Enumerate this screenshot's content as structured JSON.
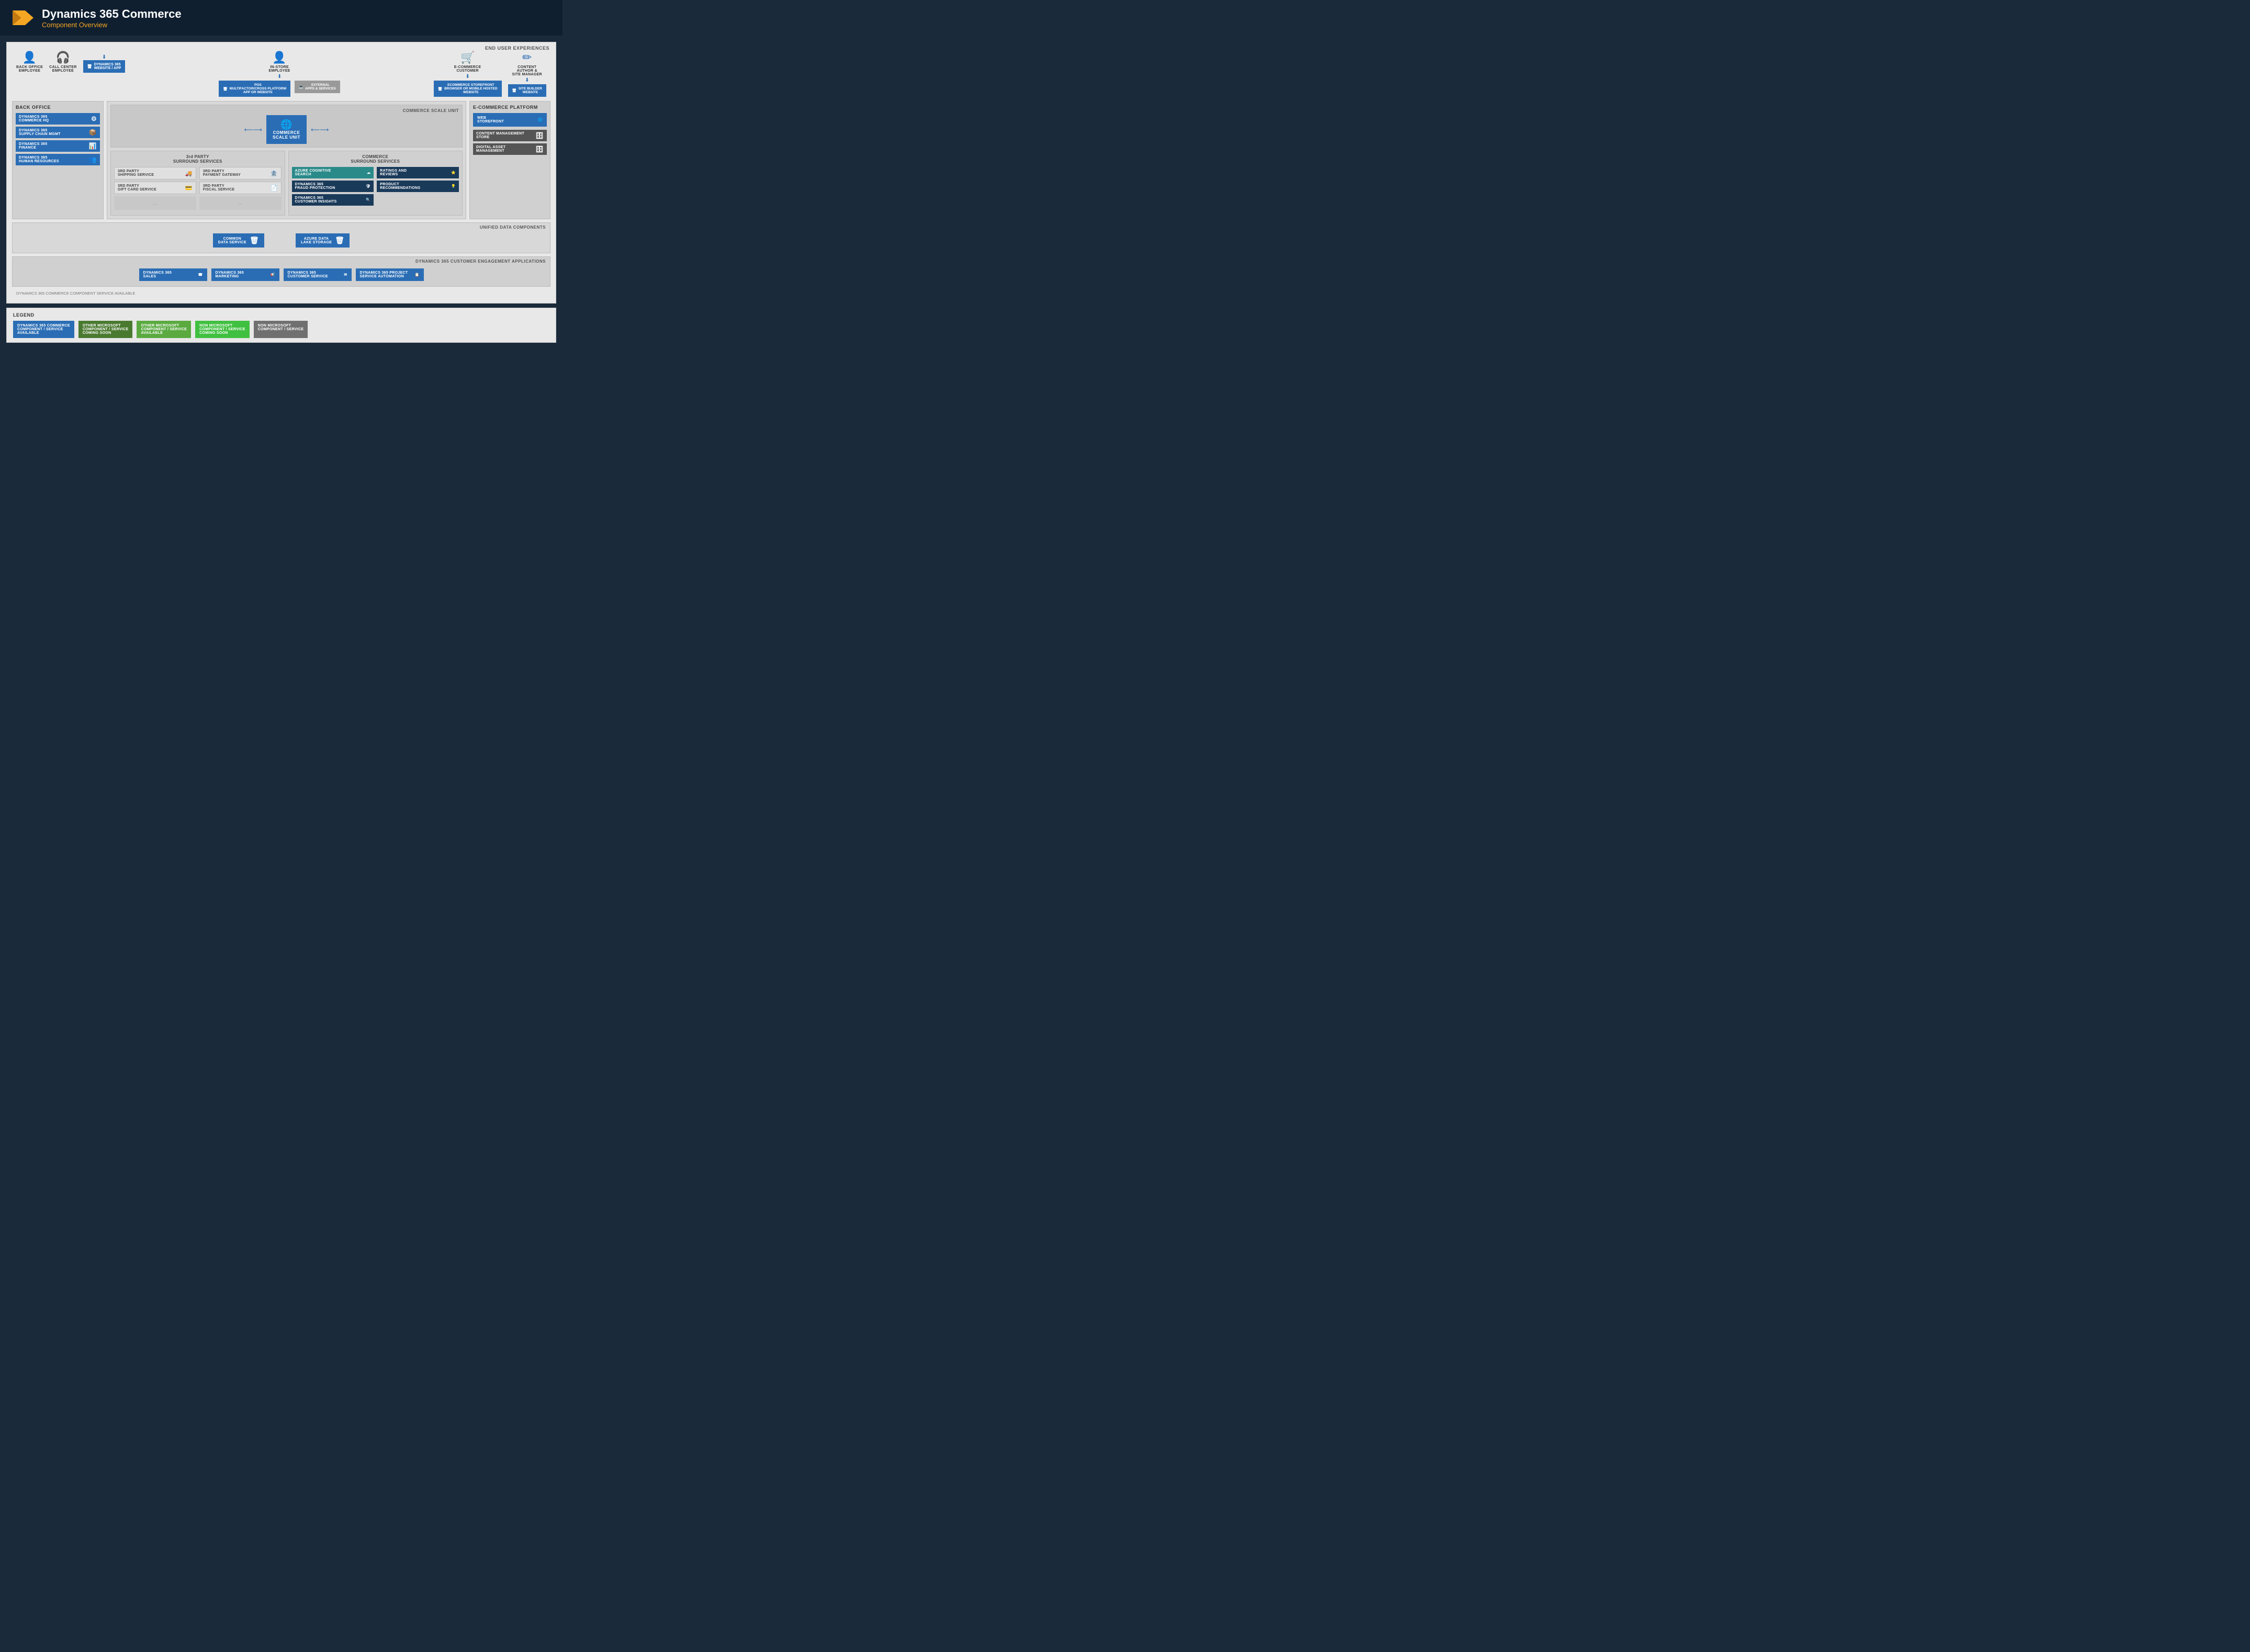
{
  "header": {
    "title": "Dynamics 365 Commerce",
    "subtitle": "Component Overview"
  },
  "diagram": {
    "section_label": "END USER EXPERIENCES",
    "users": {
      "left_group": [
        {
          "label": "BACK OFFICE\nEMPLOYEE",
          "icon": "👤"
        },
        {
          "label": "CALL CENTER\nEMPLOYEE",
          "icon": "🎧"
        }
      ],
      "left_device": {
        "label": "DYNAMICS 365\nWEBSITE / APP",
        "sublabel": ""
      },
      "center_person": {
        "label": "IN-STORE\nEMPLOYEE",
        "icon": "👤"
      },
      "center_devices": [
        {
          "label": "POS\nMULTIFACTOR/CROSS PLATFORM\nAPP OR WEBSITE"
        },
        {
          "label": "EXTERNAL\nAPPS & SERVICES"
        }
      ],
      "right_group": [
        {
          "label": "E-COMMERCE\nCUSTOMER",
          "icon": "👤"
        },
        {
          "label": "CONTENT AUTHOR &\nSITE MANAGER",
          "icon": "👤"
        }
      ],
      "right_devices": [
        {
          "label": "ECOMMERCE STOREFRONT\nBROWSER OR MOBILE HOSTED\nWEBSITE"
        },
        {
          "label": "SITE BUILDER\nWEBSITE"
        }
      ]
    },
    "back_office": {
      "title": "BACK OFFICE",
      "items": [
        {
          "label": "DYNAMICS 365\nCOMMERCE HQ"
        },
        {
          "label": "DYNAMICS 365\nSUPPLY CHAIN MGMT"
        },
        {
          "label": "DYNAMICS 365\nFINANCE"
        },
        {
          "label": "DYNAMICS 365\nHUMAN RESOURCES"
        }
      ]
    },
    "commerce_scale_unit": {
      "title": "COMMERCE SCALE UNIT",
      "box_label": "COMMERCE\nSCALE UNIT"
    },
    "third_party": {
      "title": "3rd PARTY\nSURROUND SERVICES",
      "left_services": [
        {
          "label": "3RD PARTY\nSHIPPING SERVICE"
        },
        {
          "label": "3RD PARTY\nGIFT CARD SERVICE"
        },
        {
          "label": "..."
        }
      ],
      "right_services": [
        {
          "label": "3RD PARTY\nPAYMENT GATEWAY"
        },
        {
          "label": "3RD PARTY\nFISCAL SERVICE"
        },
        {
          "label": "..."
        }
      ]
    },
    "commerce_surround": {
      "title": "COMMERCE\nSURROUND SERVICES",
      "left_items": [
        {
          "label": "AZURE COGNITIVE\nSEARCH",
          "color": "teal"
        },
        {
          "label": "DYNAMICS 365\nFRAUD PROTECTION",
          "color": "dark-navy"
        },
        {
          "label": "DYNAMICS 365\nCUSTOMER INSIGHTS",
          "color": "dark-navy"
        }
      ],
      "right_items": [
        {
          "label": "RATINGS AND\nREVIEWS",
          "color": "dark-navy"
        },
        {
          "label": "PRODUCT\nRECOMMENDATIONS",
          "color": "dark-navy"
        }
      ]
    },
    "ecommerce_platform": {
      "title": "E-COMMERCE PLATFORM",
      "web_storefront": "WEB\nSTOREFRONT",
      "items": [
        {
          "label": "CONTENT MANAGEMENT\nSTORE"
        },
        {
          "label": "DIGITAL ASSET\nMANAGEMENT"
        }
      ]
    },
    "unified_data": {
      "label": "UNIFIED DATA COMPONENTS",
      "items": [
        {
          "label": "COMMON\nDATA SERVICE"
        },
        {
          "label": "AZURE DATA\nLAKE STORAGE"
        }
      ]
    },
    "engagement": {
      "label": "DYNAMICS 365 CUSTOMER ENGAGEMENT APPLICATIONS",
      "items": [
        {
          "label": "DYNAMICS 365\nSALES"
        },
        {
          "label": "DYNAMICS 365\nMARKETING"
        },
        {
          "label": "DYNAMICS 365\nCUSTOMER SERVICE"
        },
        {
          "label": "DYNAMICS 365 PROJECT\nSERVICE AUTOMATION"
        }
      ]
    }
  },
  "legend": {
    "title": "LEGEND",
    "items": [
      {
        "label": "DYNAMICS 365 COMMERCE\nCOMPONENT / SERVICE\nAVAILABLE",
        "color": "blue"
      },
      {
        "label": "OTHER MICROSOFT\nCOMPONENT / SERVICE\nCOMING SOON",
        "color": "green-dark"
      },
      {
        "label": "OTHER MICROSOFT\nCOMPONENT / SERVICE\nAVAILABLE",
        "color": "green-light"
      },
      {
        "label": "NON MICROSOFT\nCOMPONENT / SERVICE\nCOMING SOON",
        "color": "green-bright"
      },
      {
        "label": "NON MICROSOFT\nCOMPONENT / SERVICE",
        "color": "gray-dark"
      }
    ]
  }
}
